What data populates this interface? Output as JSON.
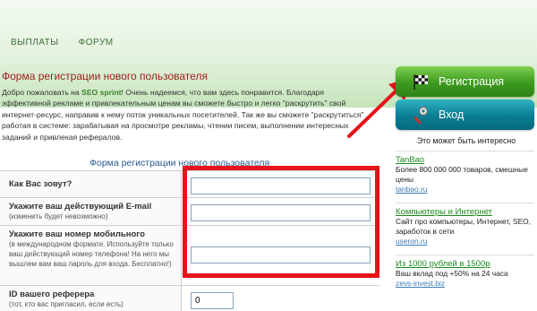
{
  "nav": {
    "items": [
      "ВЫПЛАТЫ",
      "ФОРУМ"
    ]
  },
  "page": {
    "title": "Форма регистрации нового пользователя",
    "intro_before": "Добро пожаловать на ",
    "intro_brand": "SEO sprint",
    "intro_after": "! Очень надеемся, что вам здесь понравится. Благодаря эффективной рекламе и привлекательным ценам вы сможете быстро и легко \"раскрутить\" свой интернет-ресурс, направив к нему поток уникальных посетителей. Так же вы сможете \"раскрутиться\" работая в системе: зарабатывая на просмотре рекламы, чтении писем, выполнении интересных заданий и привлекая рефералов."
  },
  "form": {
    "heading": "Форма регистрации нового пользователя",
    "name_label": "Как Вас зовут?",
    "name_value": "",
    "email_label": "Укажите ваш действующий E-mail",
    "email_hint": "(изменить будет невозможно)",
    "email_value": "",
    "phone_label": "Укажите ваш номер мобильного",
    "phone_hint": "(в международном формате. Используйте только ваш действующий номер телефона! На него мы вышлем вам ваш пароль для входа. Бесплатно!)",
    "phone_value": "",
    "referer_label": "ID вашего реферера",
    "referer_hint": "(тот, кто вас пригласил, если есть)",
    "referer_value": "0"
  },
  "sidebar": {
    "register_label": "Регистрация",
    "login_label": "Вход",
    "interesting_title": "Это может быть интересно",
    "ads": [
      {
        "title": "TanBao",
        "desc": "Более 800 000 000 товаров, смешные цены",
        "url": "tanbao.ru"
      },
      {
        "title": "Компьютеры и Интернет",
        "desc": "Сайт про компьютеры, Интернет, SEO, заработок в сети",
        "url": "useron.ru"
      },
      {
        "title": "Из 1000 рублей в 1500р",
        "desc": "Ваш вклад под +50% на 24 часа",
        "url": "zevs-invest.biz"
      }
    ]
  },
  "colors": {
    "annotation_red": "#e8121a",
    "register_green": "#3c9a1f",
    "login_teal": "#0a7d93"
  },
  "icons": {
    "register": "checkered-flag-icon",
    "login": "key-icon"
  }
}
